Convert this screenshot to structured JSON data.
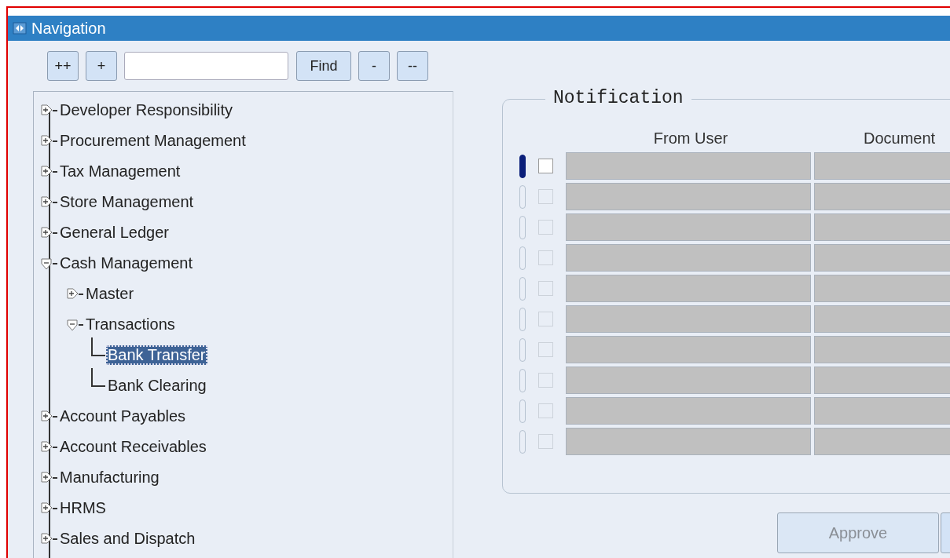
{
  "window": {
    "title": "Navigation"
  },
  "toolbar": [
    {
      "kind": "button",
      "label": "++"
    },
    {
      "kind": "button",
      "label": "+"
    },
    {
      "kind": "field"
    },
    {
      "kind": "button",
      "label": "Find"
    },
    {
      "kind": "button",
      "label": "-"
    },
    {
      "kind": "button",
      "label": "--"
    }
  ],
  "tree": [
    {
      "label": "Developer Responsibility",
      "expanded": false,
      "selected": false
    },
    {
      "label": "Procurement Management",
      "expanded": false,
      "selected": false
    },
    {
      "label": "Tax Management",
      "expanded": false,
      "selected": false
    },
    {
      "label": "Store Management",
      "expanded": false,
      "selected": false
    },
    {
      "label": "General Ledger",
      "expanded": false,
      "selected": false
    },
    {
      "label": "Cash Management",
      "expanded": true,
      "selected": false,
      "children": [
        {
          "label": "Master",
          "expanded": false,
          "selected": false
        },
        {
          "label": "Transactions",
          "expanded": true,
          "selected": false,
          "children": [
            {
              "label": "Bank Transfer",
              "selected": true
            },
            {
              "label": "Bank Clearing",
              "selected": false
            }
          ]
        }
      ]
    },
    {
      "label": "Account Payables",
      "expanded": false,
      "selected": false
    },
    {
      "label": "Account Receivables",
      "expanded": false,
      "selected": false
    },
    {
      "label": "Manufacturing",
      "expanded": false,
      "selected": false
    },
    {
      "label": "HRMS",
      "expanded": false,
      "selected": false
    },
    {
      "label": "Sales and Dispatch",
      "expanded": false,
      "selected": false
    }
  ],
  "notification": {
    "title": "Notification",
    "columns": [
      "From User",
      "Document"
    ],
    "rows": [
      {
        "current": true,
        "checked": false
      },
      {
        "current": false,
        "checked": false
      },
      {
        "current": false,
        "checked": false
      },
      {
        "current": false,
        "checked": false
      },
      {
        "current": false,
        "checked": false
      },
      {
        "current": false,
        "checked": false
      },
      {
        "current": false,
        "checked": false
      },
      {
        "current": false,
        "checked": false
      },
      {
        "current": false,
        "checked": false
      },
      {
        "current": false,
        "checked": false
      }
    ],
    "buttons": [
      {
        "kind": "button",
        "label": "Approve",
        "disabled": true
      },
      {
        "kind": "cut_off"
      }
    ]
  }
}
